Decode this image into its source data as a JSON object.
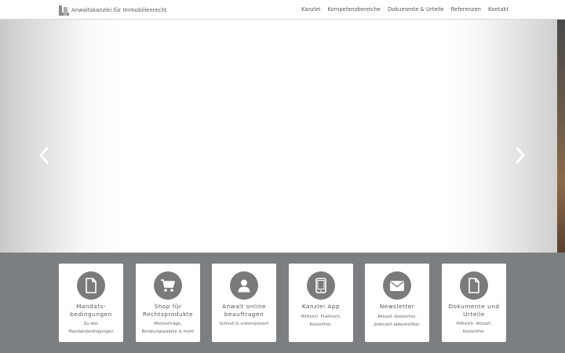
{
  "header": {
    "logo_text": "Anwaltskanzlei für Immobilienrecht",
    "nav": [
      "Kanzlei",
      "Kompetenzbereiche",
      "Dokumente & Urteile",
      "Referenzen",
      "Kontakt"
    ]
  },
  "slider": {
    "prev_icon": "chevron-left-icon",
    "next_icon": "chevron-right-icon"
  },
  "cards": [
    {
      "title": "Mandats-\nbedingungen",
      "subtitle": "Zu den\nMandatsbedingungen",
      "icon": "document-icon"
    },
    {
      "title": "Shop für\nRechtsprodukte",
      "subtitle": "Mietverträge,\nBeratungspakete & mehr",
      "icon": "cart-icon"
    },
    {
      "title": "Anwalt online\nbeauftragen",
      "subtitle": "Schnell & unkompliziert",
      "icon": "user-icon"
    },
    {
      "title": "Kanzlei App",
      "subtitle": "Hilfreich. Praktisch.\nKostenfrei.",
      "icon": "tablet-icon"
    },
    {
      "title": "Newsletter",
      "subtitle": "Aktuell. Kostenfrei.\nJederzeit abbestellbar.",
      "icon": "envelope-icon"
    },
    {
      "title": "Dokumente und\nUrteile",
      "subtitle": "Hilfreich. Aktuell.\nKostenfrei.",
      "icon": "document-icon"
    }
  ],
  "colors": {
    "cards_background": "#7b7f82",
    "icon_circle": "#7a7a7a"
  }
}
